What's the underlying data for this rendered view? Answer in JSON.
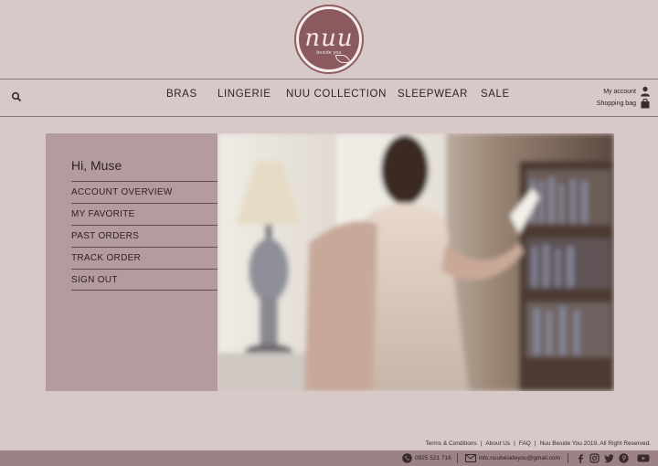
{
  "logo": {
    "text": "nuu",
    "subtitle": "beside you"
  },
  "nav": {
    "items": [
      "BRAS",
      "LINGERIE",
      "NUU COLLECTION",
      "SLEEPWEAR",
      "SALE"
    ]
  },
  "account": {
    "my_account_label": "My account",
    "shopping_bag_label": "Shopping bag"
  },
  "panel": {
    "greeting": "Hi, Muse",
    "menu": [
      "ACCOUNT OVERVIEW",
      "MY FAVORITE",
      "PAST ORDERS",
      "TRACK ORDER",
      "SIGN OUT"
    ]
  },
  "footer": {
    "links": [
      "Terms & Conditions",
      "About Us",
      "FAQ",
      "Nuu Beside You 2019. All Right Reserved."
    ],
    "phone": "0925 521 716",
    "email": "info.nuubesideyou@gmail.com",
    "social_icons": [
      "facebook-icon",
      "instagram-icon",
      "twitter-icon",
      "pinterest-icon",
      "youtube-icon"
    ]
  },
  "colors": {
    "background": "#d8c9c9",
    "panel": "#b39b9f",
    "footer_bar": "#9a8286",
    "logo": "#8a5a5f"
  }
}
